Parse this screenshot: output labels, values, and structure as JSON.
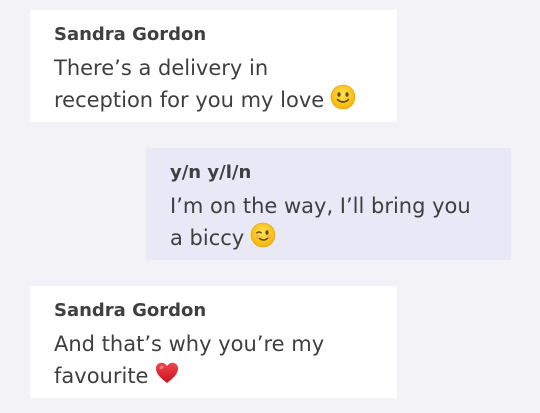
{
  "messages": [
    {
      "sender": "Sandra Gordon",
      "lines": [
        "There’s a delivery in",
        "reception for you my love"
      ],
      "emoji": "slightly-smiling-face"
    },
    {
      "sender": "y/n y/l/n",
      "lines": [
        "I’m on the way, I’ll bring you",
        "a biccy"
      ],
      "emoji": "winking-face"
    },
    {
      "sender": "Sandra Gordon",
      "lines": [
        "And that’s why you’re my",
        "favourite"
      ],
      "emoji": "red-heart"
    }
  ],
  "colors": {
    "background": "#f3f2f7",
    "incoming_bubble": "#ffffff",
    "outgoing_bubble": "#e8e8f6",
    "text": "#3f3f3f"
  }
}
